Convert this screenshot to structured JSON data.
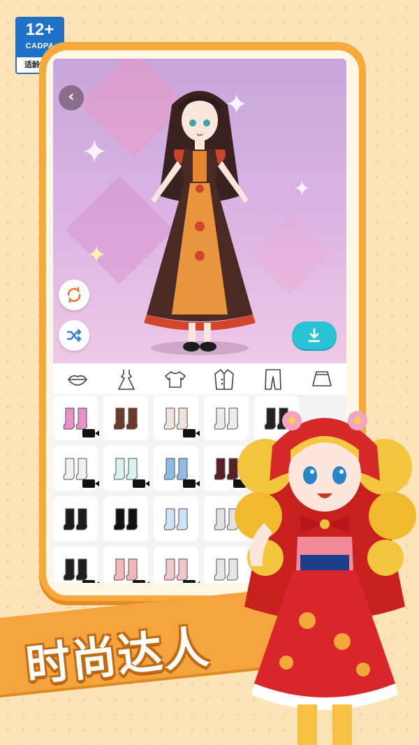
{
  "age_rating": {
    "age": "12+",
    "org": "CADPA",
    "hint": "适龄提示"
  },
  "toolbar": {
    "back_icon": "chevron-left-icon",
    "refresh_icon": "refresh-icon",
    "shuffle_icon": "shuffle-icon",
    "download_icon": "download-icon"
  },
  "categories": [
    {
      "name": "lips",
      "icon": "lips-icon"
    },
    {
      "name": "dress",
      "icon": "dress-icon"
    },
    {
      "name": "top",
      "icon": "top-icon"
    },
    {
      "name": "coat",
      "icon": "coat-icon"
    },
    {
      "name": "pants",
      "icon": "pants-icon"
    },
    {
      "name": "skirt",
      "icon": "skirt-icon"
    }
  ],
  "shoes": [
    {
      "color": "#e890c8",
      "video": true
    },
    {
      "color": "#6b3a2a",
      "video": false
    },
    {
      "color": "#f1e3dc",
      "video": true
    },
    {
      "color": "#ececec",
      "video": false
    },
    {
      "color": "#222222",
      "video": false
    },
    {
      "color": "#f0f0f0",
      "video": true
    },
    {
      "color": "#d8f3f0",
      "video": true
    },
    {
      "color": "#8fbbe8",
      "video": true
    },
    {
      "color": "#5b1f2a",
      "video": true
    },
    {
      "color": "#333333",
      "video": false
    },
    {
      "color": "#1b1b1b",
      "video": false
    },
    {
      "color": "#111111",
      "video": false
    },
    {
      "color": "#cfe3f6",
      "video": false
    },
    {
      "color": "#e2e2e2",
      "video": false
    },
    {
      "color": "#d9d9d9",
      "video": false
    },
    {
      "color": "#1f1f1f",
      "video": true
    },
    {
      "color": "#f4b6b6",
      "video": true
    },
    {
      "color": "#f1c7cc",
      "video": true
    },
    {
      "color": "#e6e6e6",
      "video": false
    },
    {
      "color": "#e6e6e6",
      "video": false
    }
  ],
  "banner": {
    "text": "时尚达人"
  },
  "colors": {
    "background": "#fde3b8",
    "frame": "#f8a93c",
    "download": "#28c2d4",
    "stage": "#d6b4e2"
  }
}
